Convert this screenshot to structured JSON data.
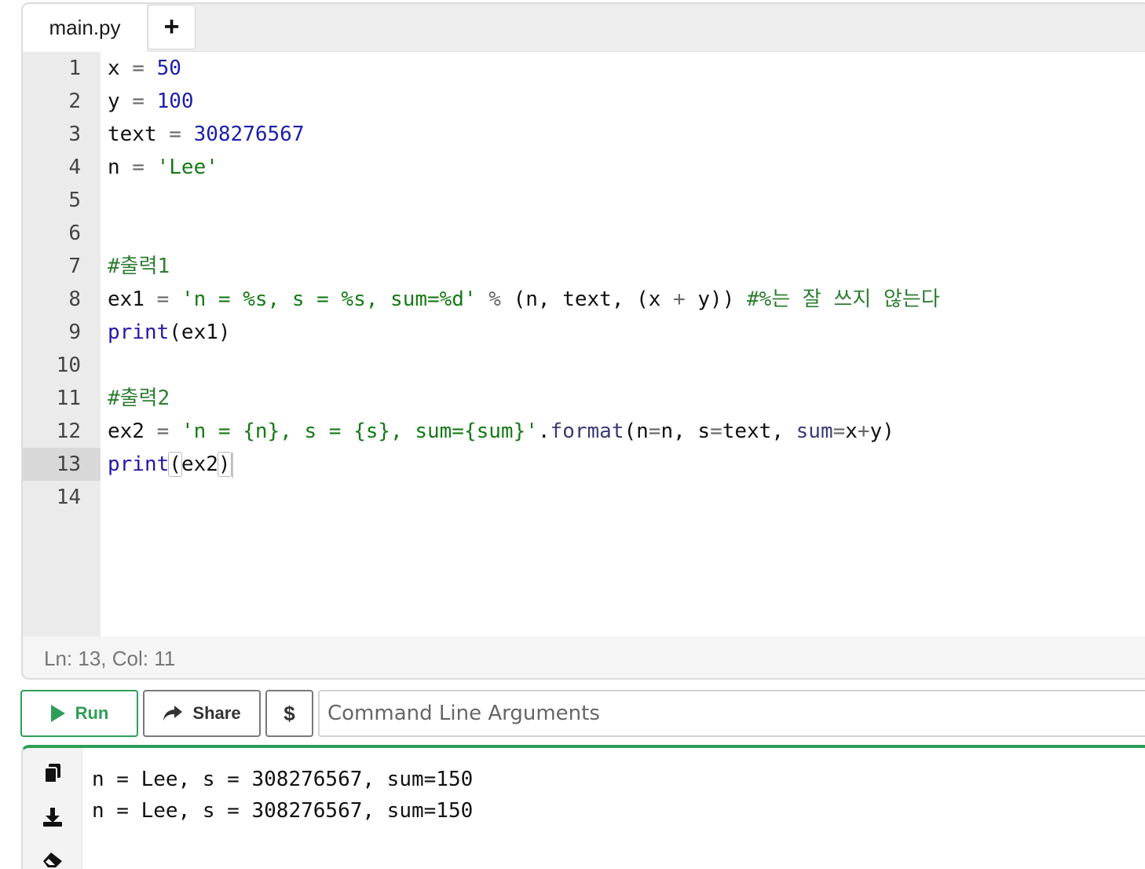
{
  "editor": {
    "tab_name": "main.py",
    "add_tab_label": "+",
    "lines": [
      {
        "n": "1"
      },
      {
        "n": "2"
      },
      {
        "n": "3"
      },
      {
        "n": "4"
      },
      {
        "n": "5"
      },
      {
        "n": "6"
      },
      {
        "n": "7"
      },
      {
        "n": "8"
      },
      {
        "n": "9"
      },
      {
        "n": "10"
      },
      {
        "n": "11"
      },
      {
        "n": "12"
      },
      {
        "n": "13"
      },
      {
        "n": "14"
      }
    ],
    "active_line": "13",
    "code": {
      "l1": [
        "x",
        " = ",
        "50"
      ],
      "l2": [
        "y",
        " = ",
        "100"
      ],
      "l3": [
        "text",
        " = ",
        "308276567"
      ],
      "l4": [
        "n",
        " = ",
        "'Lee'"
      ],
      "l7": "#출력1",
      "l8": [
        "ex1",
        " = ",
        "'n = %s, s = %s, sum=%d'",
        " % ",
        "(n, text, (x ",
        "+",
        " y)) ",
        "#%는 잘 쓰지 않는다"
      ],
      "l9": [
        "print",
        "(ex1)"
      ],
      "l11": "#출력2",
      "l12": [
        "ex2",
        " = ",
        "'n = {n}, s = {s}, sum={sum}'",
        ".",
        "format",
        "(n",
        "=",
        "n, s",
        "=",
        "text, ",
        "sum",
        "=",
        "x",
        "+",
        "y)"
      ],
      "l13": [
        "print",
        "(",
        "ex2",
        ")"
      ]
    },
    "status": "Ln: 13,  Col: 11"
  },
  "toolbar": {
    "run_label": "Run",
    "share_label": "Share",
    "dollar_label": "$",
    "args_placeholder": "Command Line Arguments"
  },
  "output": {
    "lines": [
      "n = Lee, s = 308276567, sum=150",
      "n = Lee, s = 308276567, sum=150"
    ]
  },
  "icons": {
    "run": "play-icon",
    "share": "share-arrow-icon",
    "copy": "copy-icon",
    "download": "download-icon",
    "clear": "eraser-icon"
  },
  "colors": {
    "accent": "#2e9e57",
    "number": "#1c1fa8",
    "string": "#157a15",
    "comment": "#2e7d32"
  }
}
